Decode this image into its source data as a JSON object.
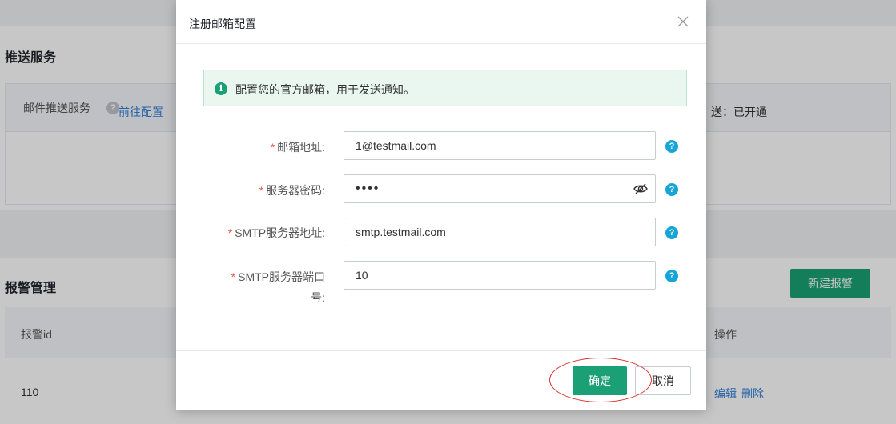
{
  "background": {
    "push_section": {
      "title": "推送服务",
      "header_label": "邮件推送服务",
      "help_glyph": "?",
      "configure_link": "前往配置",
      "status_text": "送：已开通"
    },
    "alert_section": {
      "title": "报警管理",
      "new_button": "新建报警",
      "columns": {
        "id": "报警id",
        "ops": "操作"
      },
      "row": {
        "id": "110",
        "edit": "编辑",
        "delete": "删除"
      }
    }
  },
  "dialog": {
    "title": "注册邮箱配置",
    "info": {
      "icon_glyph": "i",
      "text": "配置您的官方邮箱，用于发送通知。"
    },
    "required_mark": "*",
    "fields": {
      "email": {
        "label": "邮箱地址:",
        "value": "1@testmail.com"
      },
      "password": {
        "label": "服务器密码:",
        "value": "••••"
      },
      "smtp_host": {
        "label": "SMTP服务器地址:",
        "value": "smtp.testmail.com"
      },
      "smtp_port": {
        "label_line1": "SMTP服务器端口",
        "label_line2": "号:",
        "value": "10"
      }
    },
    "help_glyph": "?",
    "buttons": {
      "ok": "确定",
      "cancel": "取消"
    }
  },
  "colors": {
    "primary": "#1aa074",
    "link": "#2f7ed8",
    "help": "#16a5d6",
    "required": "#e8564b",
    "annotation": "#d9302a"
  },
  "icons": [
    "close-icon",
    "info-icon",
    "eye-slash-icon",
    "help-icon"
  ]
}
